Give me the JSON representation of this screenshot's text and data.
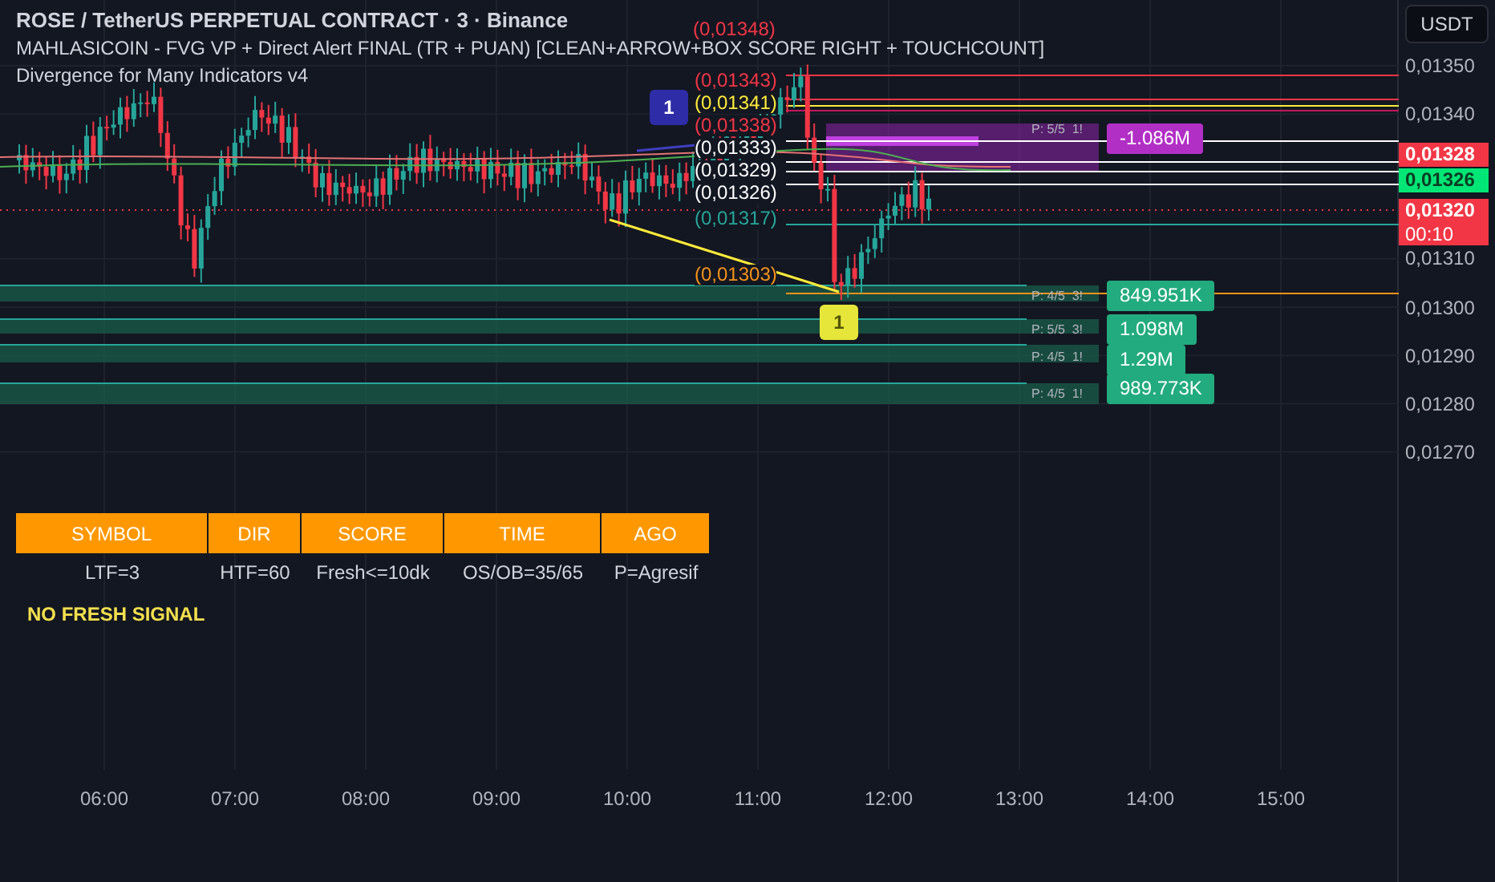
{
  "header": {
    "title": "ROSE / TetherUS PERPETUAL CONTRACT · 3 · Binance",
    "indicators": [
      "MAHLASICOIN - FVG VP + Direct Alert FINAL (TR + PUAN) [CLEAN+ARROW+BOX SCORE RIGHT + TOUCHCOUNT]",
      "Divergence for Many Indicators v4"
    ]
  },
  "currency_button": "USDT",
  "price_axis": [
    "0,01350",
    "0,01340",
    "0,01310",
    "0,01300",
    "0,01290",
    "0,01280",
    "0,01270"
  ],
  "price_tags": [
    {
      "text": "0,01328",
      "kind": "ask"
    },
    {
      "text": "0,01326",
      "kind": "bid"
    },
    {
      "text": "0,01320",
      "countdown": "00:10",
      "kind": "last"
    }
  ],
  "time_axis": [
    "06:00",
    "07:00",
    "08:00",
    "09:00",
    "10:00",
    "11:00",
    "12:00",
    "13:00",
    "14:00",
    "15:00"
  ],
  "level_labels": [
    {
      "text": "(0,01348)",
      "color": "#f23645"
    },
    {
      "text": "(0,01343)",
      "color": "#f23645"
    },
    {
      "text": "(0,01341)",
      "color": "#ffeb3b"
    },
    {
      "text": "(0,01338)",
      "color": "#f23645"
    },
    {
      "text": "(0,01333)",
      "color": "#ffffff"
    },
    {
      "text": "(0,01329)",
      "color": "#ffffff"
    },
    {
      "text": "(0,01326)",
      "color": "#ffffff"
    },
    {
      "text": "(0,01317)",
      "color": "#26a69a"
    },
    {
      "text": "(0,01303)",
      "color": "#f7931a"
    }
  ],
  "zone_labels": [
    "P: 5/5  1!",
    "P: 4/5  3!",
    "P: 5/5  3!",
    "P: 4/5  1!",
    "P: 4/5  1!"
  ],
  "volume_labels": [
    {
      "text": "-1.086M",
      "kind": "bearish"
    },
    {
      "text": "849.951K",
      "kind": "bullish"
    },
    {
      "text": "1.098M",
      "kind": "bullish"
    },
    {
      "text": "1.29M",
      "kind": "bullish"
    },
    {
      "text": "989.773K",
      "kind": "bullish"
    }
  ],
  "markers": [
    {
      "text": "1",
      "kind": "bearish"
    },
    {
      "text": "1",
      "kind": "bullish"
    }
  ],
  "screener_table": {
    "columns": [
      "SYMBOL",
      "DIR",
      "SCORE",
      "TIME",
      "AGO"
    ],
    "row": [
      "LTF=3",
      "HTF=60",
      "Fresh<=10dk",
      "OS/OB=35/65",
      "P=Agresif"
    ]
  },
  "signal_text": "NO FRESH SIGNAL"
}
